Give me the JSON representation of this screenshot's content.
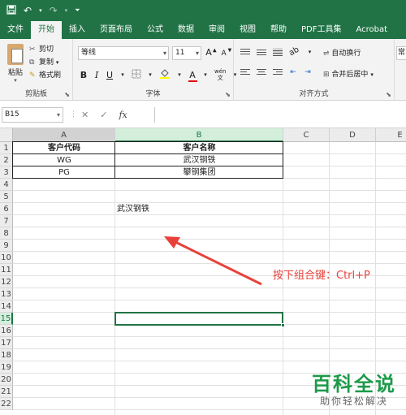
{
  "ribbon_tabs": [
    "文件",
    "开始",
    "插入",
    "页面布局",
    "公式",
    "数据",
    "审阅",
    "视图",
    "帮助",
    "PDF工具集",
    "Acrobat"
  ],
  "active_tab_index": 1,
  "clipboard": {
    "paste": "粘贴",
    "cut": "剪切",
    "copy": "复制",
    "format_painter": "格式刷",
    "group_label": "剪贴板"
  },
  "font": {
    "family": "等线",
    "size": "11",
    "group_label": "字体",
    "bold": "B",
    "italic": "I",
    "underline": "U",
    "grow": "A",
    "shrink": "A",
    "phonetic": "wén"
  },
  "alignment": {
    "wrap_text": "自动换行",
    "merge_center": "合并后居中",
    "group_label": "对齐方式"
  },
  "number_group_label": "常",
  "formula_bar": {
    "name_box": "B15",
    "cancel": "✕",
    "enter": "✓",
    "fx": "fx",
    "formula": ""
  },
  "columns": [
    "A",
    "B",
    "C",
    "D",
    "E"
  ],
  "rows": [
    "1",
    "2",
    "3",
    "4",
    "5",
    "6",
    "7",
    "8",
    "9",
    "10",
    "11",
    "12",
    "13",
    "14",
    "15",
    "16",
    "17",
    "18",
    "19",
    "20",
    "21",
    "22"
  ],
  "active_cell": "B15",
  "table": {
    "header_code": "客户代码",
    "header_name": "客户名称",
    "rows": [
      {
        "code": "WG",
        "name": "武汉钢铁"
      },
      {
        "code": "PG",
        "name": "攀钢集团"
      }
    ]
  },
  "cell_b6": "武汉钢铁",
  "annotation": "按下组合键：Ctrl+P",
  "annotation_color": "#e8413b",
  "accent_color": "#217346",
  "watermark": {
    "title": "百科全说",
    "subtitle": "助你轻松解决"
  }
}
